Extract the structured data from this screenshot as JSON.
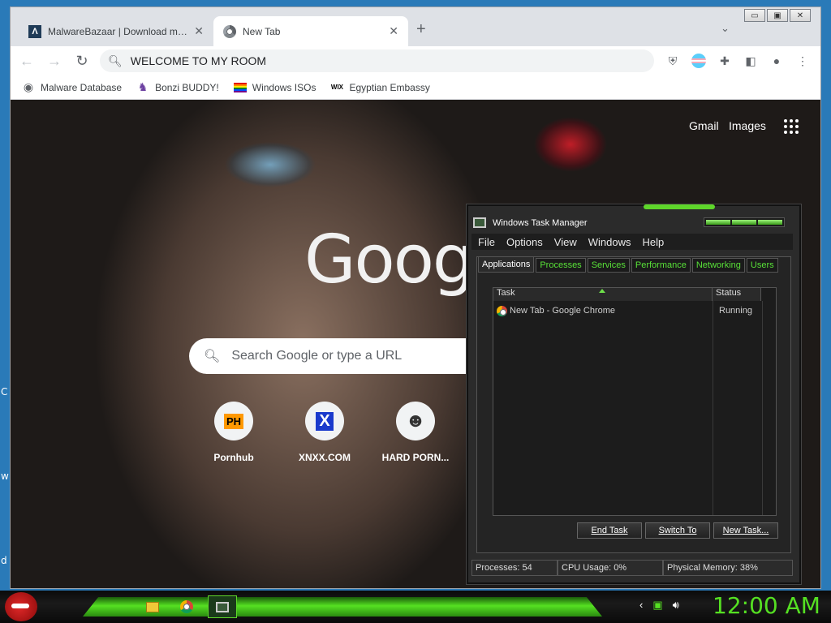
{
  "desktop": {
    "fragments": [
      "C",
      "w",
      "d"
    ]
  },
  "chrome": {
    "tabs": [
      {
        "title": "MalwareBazaar | Download malware samples",
        "icon": "malwarebazaar-favicon"
      },
      {
        "title": "New Tab",
        "icon": "chrome-favicon"
      }
    ],
    "new_tab_symbol": "+",
    "tab_menu_symbol": "⌄",
    "window_controls": {
      "minimize": "▭",
      "restore": "▣",
      "close": "✕"
    },
    "omnibox": {
      "value": "WELCOME TO MY ROOM"
    },
    "bookmarks": [
      {
        "label": "Malware Database",
        "icon": "globe-icon"
      },
      {
        "label": "Bonzi BUDDY!",
        "icon": "bonzi-icon"
      },
      {
        "label": "Windows ISOs",
        "icon": "rainbow-flag-icon"
      },
      {
        "label": "Egyptian Embassy",
        "icon": "wix-icon"
      }
    ],
    "bookmark_wix_text": "WIX",
    "page": {
      "gmail": "Gmail",
      "images": "Images",
      "logo": "Goog",
      "search_placeholder": "Search Google or type a URL",
      "shortcuts": [
        {
          "label": "Pornhub",
          "glyph": "PH"
        },
        {
          "label": "XNXX.COM",
          "glyph": "X"
        },
        {
          "label": "HARD PORN...",
          "glyph": "☻"
        }
      ]
    }
  },
  "taskmgr": {
    "title": "Windows Task Manager",
    "menu": [
      "File",
      "Options",
      "View",
      "Windows",
      "Help"
    ],
    "tabs": [
      "Applications",
      "Processes",
      "Services",
      "Performance",
      "Networking",
      "Users"
    ],
    "active_tab": "Applications",
    "columns": {
      "task": "Task",
      "status": "Status"
    },
    "rows": [
      {
        "task": "New Tab - Google Chrome",
        "status": "Running"
      }
    ],
    "buttons": {
      "end_task": "End Task",
      "switch_to": "Switch To",
      "new_task": "New Task..."
    },
    "status": {
      "processes": "Processes: 54",
      "cpu": "CPU Usage: 0%",
      "memory": "Physical Memory: 38%"
    }
  },
  "taskbar": {
    "clock": "12:00 AM"
  },
  "colors": {
    "accent_green": "#55e022",
    "chrome_bg": "#dee1e6"
  }
}
